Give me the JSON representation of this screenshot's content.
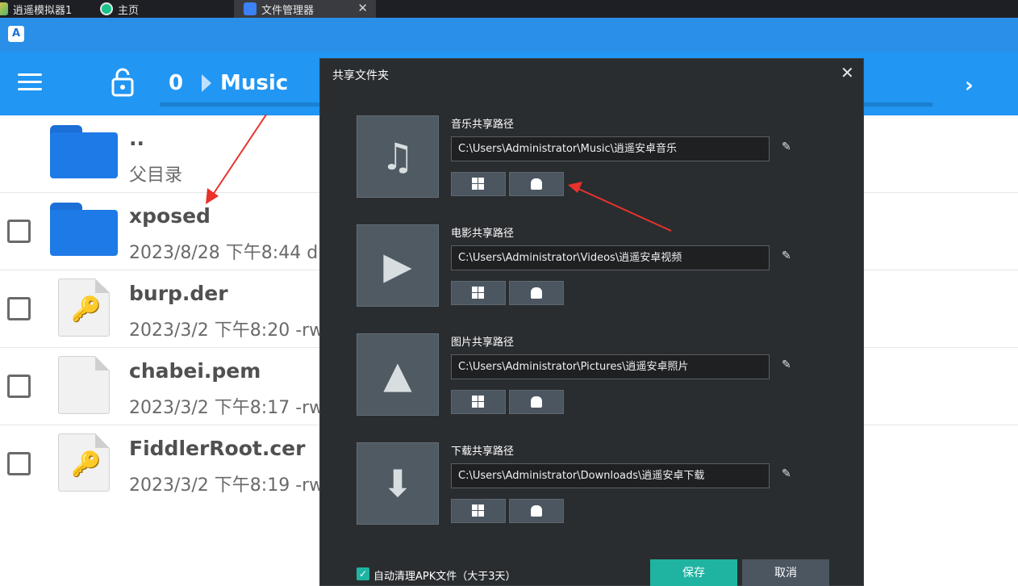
{
  "tabs": [
    {
      "label": "逍遥模拟器1",
      "icon": "emulator-icon"
    },
    {
      "label": "主页",
      "icon": "home-icon"
    },
    {
      "label": "文件管理器",
      "icon": "file-manager-icon",
      "close": "✕"
    }
  ],
  "app": {
    "logo_letter": "A"
  },
  "toolbar": {
    "breadcrumb_root": "0",
    "breadcrumb_current": "Music",
    "next": "›"
  },
  "files": [
    {
      "name": "..",
      "meta": "父目录",
      "type": "parent-folder"
    },
    {
      "name": "xposed",
      "meta": "2023/8/28 下午8:44  d",
      "type": "folder"
    },
    {
      "name": "burp.der",
      "meta": "2023/3/2 下午8:20  -rw",
      "type": "key-file"
    },
    {
      "name": "chabei.pem",
      "meta": "2023/3/2 下午8:17  -rw",
      "type": "file"
    },
    {
      "name": "FiddlerRoot.cer",
      "meta": "2023/3/2 下午8:19  -rw",
      "type": "key-file"
    }
  ],
  "dialog": {
    "title": "共享文件夹",
    "close": "✕",
    "sections": [
      {
        "label": "音乐共享路径",
        "path": "C:\\Users\\Administrator\\Music\\逍遥安卓音乐",
        "icon": "music-note-icon",
        "glyph": "♫"
      },
      {
        "label": "电影共享路径",
        "path": "C:\\Users\\Administrator\\Videos\\逍遥安卓视频",
        "icon": "video-icon",
        "glyph": "▶"
      },
      {
        "label": "图片共享路径",
        "path": "C:\\Users\\Administrator\\Pictures\\逍遥安卓照片",
        "icon": "picture-icon",
        "glyph": "▲"
      },
      {
        "label": "下载共享路径",
        "path": "C:\\Users\\Administrator\\Downloads\\逍遥安卓下载",
        "icon": "download-folder-icon",
        "glyph": "⬇"
      }
    ],
    "auto_clean_label": "自动清理APK文件（大于3天）",
    "auto_clean_checked": true,
    "save_label": "保存",
    "cancel_label": "取消",
    "accent_color": "#1fb4a2"
  }
}
